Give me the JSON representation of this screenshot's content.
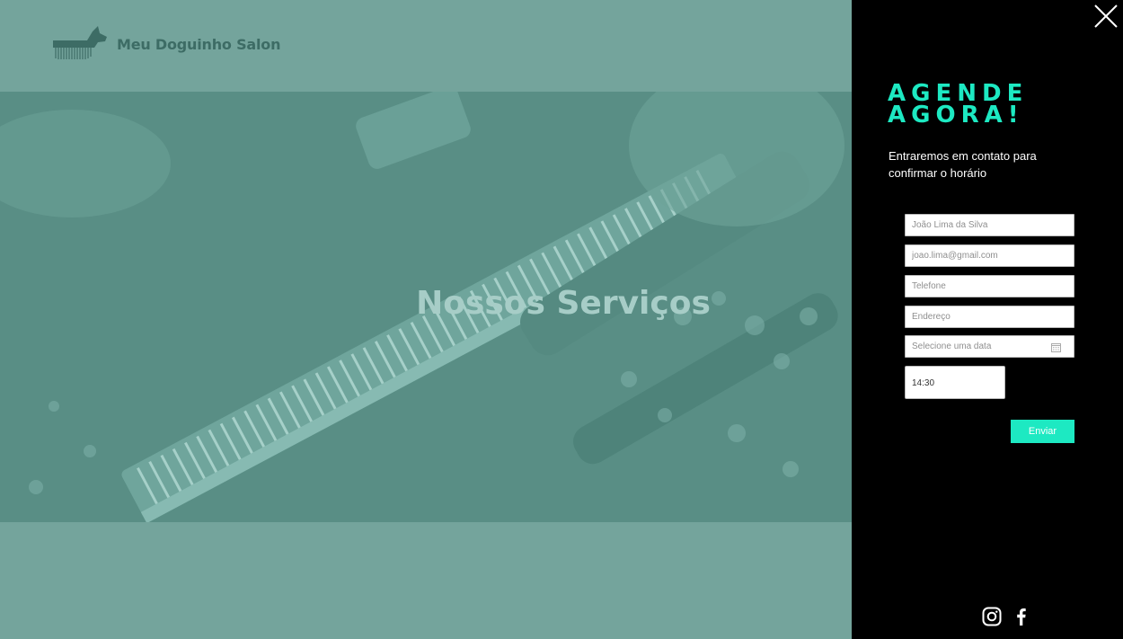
{
  "header": {
    "brand_name": "Meu Doguinho Salon"
  },
  "hero": {
    "title": "Nossos Serviços"
  },
  "booking": {
    "title_line1": "AGENDE",
    "title_line2": "AGORA!",
    "subtitle": "Entraremos em contato para confirmar o horário",
    "fields": {
      "name_placeholder": "João Lima da Silva",
      "email_placeholder": "joao.lima@gmail.com",
      "phone_placeholder": "Telefone",
      "address_placeholder": "Endereço",
      "date_placeholder": "Selecione uma data",
      "time_value": "14:30"
    },
    "submit_label": "Enviar"
  },
  "social": {
    "icons": [
      "instagram-icon",
      "facebook-icon"
    ]
  },
  "colors": {
    "accent": "#1de9c2",
    "page_bg": "#74a49c",
    "panel_bg": "#000000"
  }
}
